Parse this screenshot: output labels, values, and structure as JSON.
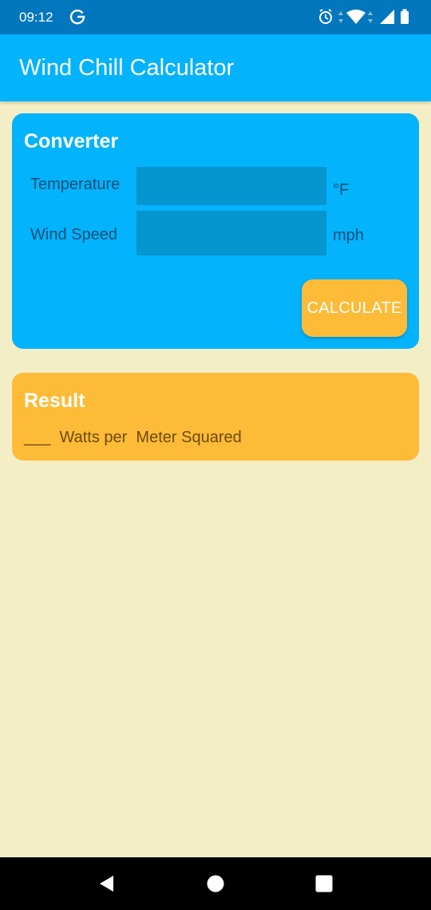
{
  "status_bar": {
    "time": "09:12",
    "icons": [
      "g-logo-icon",
      "alarm-icon",
      "data-arrows-icon",
      "wifi-icon",
      "signal-icon",
      "battery-icon"
    ]
  },
  "app_bar": {
    "title": "Wind Chill Calculator"
  },
  "converter": {
    "title": "Converter",
    "temperature_label": "Temperature",
    "temperature_value": "",
    "temperature_unit": "°F",
    "wind_speed_label": "Wind Speed",
    "wind_speed_value": "",
    "wind_speed_unit": "mph",
    "calculate_label": "CALCULATE"
  },
  "result": {
    "title": "Result",
    "text": "___  Watts per  Meter Squared"
  },
  "nav_bar": {
    "icons": [
      "back-icon",
      "home-icon",
      "recents-icon"
    ]
  },
  "colors": {
    "status_bar": "#0277BD",
    "app_bar": "#03B3FC",
    "card_blue": "#03B3FC",
    "card_orange": "#FDBB37",
    "background": "#F3EEC6",
    "input": "#0596CF"
  }
}
